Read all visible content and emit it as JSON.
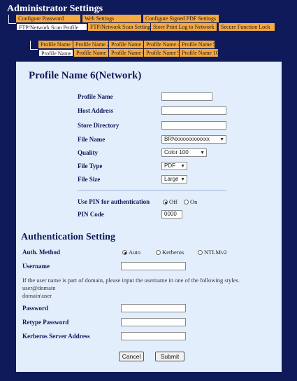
{
  "header": {
    "title": "Administrator Settings"
  },
  "tabs_row1": [
    {
      "label": "Configure Password"
    },
    {
      "label": "Web Settings"
    },
    {
      "label": "Configure Signed PDF Settings"
    }
  ],
  "tabs_row2": [
    {
      "label": "FTP/Network Scan Profile"
    },
    {
      "label": "FTP/Network Scan Settings"
    },
    {
      "label": "Store Print Log to Network"
    },
    {
      "label": "Secure Function Lock"
    }
  ],
  "tabs_row3": [
    {
      "label": "Profile Name 1"
    },
    {
      "label": "Profile Name 2"
    },
    {
      "label": "Profile Name 3"
    },
    {
      "label": "Profile Name 4"
    },
    {
      "label": "Profile Name 5"
    }
  ],
  "tabs_row4": [
    {
      "label": "Profile Name 6"
    },
    {
      "label": "Profile Name 7"
    },
    {
      "label": "Profile Name 8"
    },
    {
      "label": "Profile Name 9"
    },
    {
      "label": "Profile Name 10"
    }
  ],
  "profile": {
    "heading": "Profile Name 6(Network)",
    "profile_name_label": "Profile Name",
    "profile_name_value": "",
    "host_address_label": "Host Address",
    "host_address_value": "",
    "store_directory_label": "Store Directory",
    "store_directory_value": "",
    "file_name_label": "File Name",
    "file_name_value": "BRNxxxxxxxxxxxx",
    "quality_label": "Quality",
    "quality_value": "Color 100",
    "file_type_label": "File Type",
    "file_type_value": "PDF",
    "file_size_label": "File Size",
    "file_size_value": "Large",
    "use_pin_label": "Use PIN for authentication",
    "pin_off_label": "Off",
    "pin_on_label": "On",
    "pin_code_label": "PIN Code",
    "pin_code_value": "0000"
  },
  "auth": {
    "heading": "Authentication Setting",
    "method_label": "Auth. Method",
    "method_auto": "Auto",
    "method_kerberos": "Kerberos",
    "method_ntlm": "NTLMv2",
    "username_label": "Username",
    "username_value": "",
    "help_line1": "If the user name is part of domain, please input the username in one of the following styles.",
    "help_line2": "user@domain",
    "help_line3": "domain\\user",
    "password_label": "Password",
    "retype_label": "Retype Password",
    "kerberos_label": "Kerberos Server Address"
  },
  "buttons": {
    "cancel": "Cancel",
    "submit": "Submit"
  },
  "colors": {
    "background": "#0f1a5a",
    "panel": "#e2eefb",
    "tab_orange": "#f4a941",
    "tab_active": "#ffffff"
  }
}
